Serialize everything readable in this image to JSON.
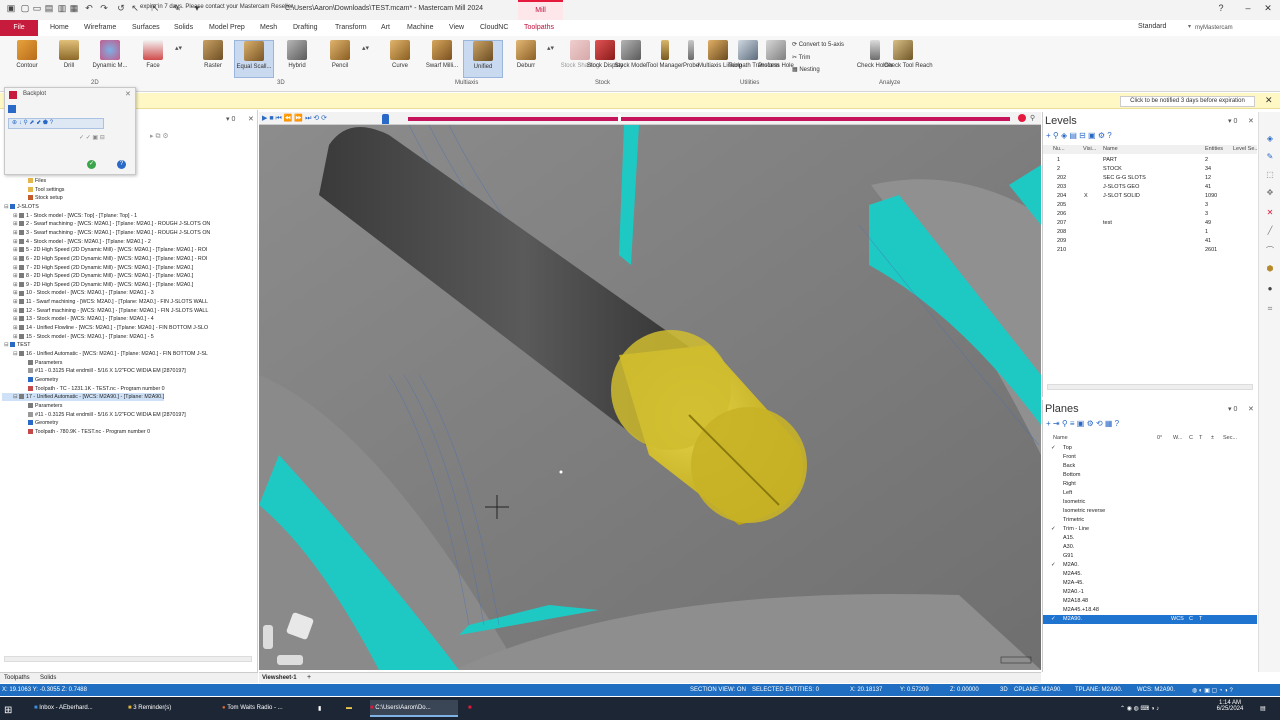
{
  "window": {
    "title": "C:\\Users\\Aaron\\Downloads\\TEST.mcam* - Mastercam Mill 2024",
    "context_tab": "Mill"
  },
  "ribbon": {
    "tabs": [
      "File",
      "Home",
      "Wireframe",
      "Surfaces",
      "Solids",
      "Model Prep",
      "Mesh",
      "Drafting",
      "Transform",
      "Art",
      "Machine",
      "View",
      "CloudNC",
      "Toolpaths"
    ],
    "active_tab": "Toolpaths",
    "workspace": "Standard",
    "my_mastercam": "myMastercam",
    "groups": {
      "2d": "2D",
      "3d": "3D",
      "multiaxis": "Multiaxis",
      "stock": "Stock",
      "utilities": "Utilities",
      "analyze": "Analyze"
    },
    "buttons_2d": [
      "Contour",
      "Drill",
      "Dynamic M...",
      "Face"
    ],
    "buttons_3d": [
      "Raster",
      "Equal Scall...",
      "Hybrid",
      "Pencil"
    ],
    "buttons_multiaxis": [
      "Curve",
      "Swarf Milli...",
      "Unified",
      "Deburr"
    ],
    "buttons_stock": [
      "Stock Shading",
      "Stock Display",
      "Stock Model"
    ],
    "buttons_utilities": [
      "Tool Manager",
      "Probe",
      "Multiaxis Linking",
      "Toolpath Transform",
      "Process Hole"
    ],
    "utilities_small": [
      "Convert to 5-axis",
      "Trim",
      "Nesting"
    ],
    "buttons_analyze": [
      "Check Holder",
      "Check Tool Reach"
    ]
  },
  "notification": {
    "text": "expire in 7 days. Please contact your Mastercam Reseller.",
    "button": "Click to be notified 3 days before expiration",
    "close": "✕"
  },
  "backplot": {
    "title": "Backplot"
  },
  "toolpath_tree": [
    {
      "indent": 2,
      "icon": "folder",
      "text": "Files"
    },
    {
      "indent": 2,
      "icon": "folder",
      "text": "Tool settings"
    },
    {
      "indent": 2,
      "icon": "stock",
      "text": "Stock setup"
    },
    {
      "indent": 0,
      "icon": "group",
      "text": "J-SLOTS",
      "expand": "⊟"
    },
    {
      "indent": 1,
      "icon": "op",
      "text": "1 - Stock model - [WCS: Top] - [Tplane: Top] - 1",
      "expand": "⊞"
    },
    {
      "indent": 1,
      "icon": "op",
      "text": "2 - Swarf machining - [WCS: M2A0.] - [Tplane: M2A0.] - ROUGH J-SLOTS ON",
      "expand": "⊞"
    },
    {
      "indent": 1,
      "icon": "op",
      "text": "3 - Swarf machining - [WCS: M2A0.] - [Tplane: M2A0.] - ROUGH J-SLOTS ON",
      "expand": "⊞"
    },
    {
      "indent": 1,
      "icon": "op",
      "text": "4 - Stock model - [WCS: M2A0.] - [Tplane: M2A0.] - 2",
      "expand": "⊞"
    },
    {
      "indent": 1,
      "icon": "op",
      "text": "5 - 2D High Speed (2D Dynamic Mill) - [WCS: M2A0.] - [Tplane: M2A0.] - ROI",
      "expand": "⊞"
    },
    {
      "indent": 1,
      "icon": "op",
      "text": "6 - 2D High Speed (2D Dynamic Mill) - [WCS: M2A0.] - [Tplane: M2A0.] - ROI",
      "expand": "⊞"
    },
    {
      "indent": 1,
      "icon": "op",
      "text": "7 - 2D High Speed (2D Dynamic Mill) - [WCS: M2A0.] - [Tplane: M2A0.]",
      "expand": "⊞"
    },
    {
      "indent": 1,
      "icon": "op",
      "text": "8 - 2D High Speed (2D Dynamic Mill) - [WCS: M2A0.] - [Tplane: M2A0.]",
      "expand": "⊞"
    },
    {
      "indent": 1,
      "icon": "op",
      "text": "9 - 2D High Speed (2D Dynamic Mill) - [WCS: M2A0.] - [Tplane: M2A0.]",
      "expand": "⊞"
    },
    {
      "indent": 1,
      "icon": "op",
      "text": "10 - Stock model - [WCS: M2A0.] - [Tplane: M2A0.] - 3",
      "expand": "⊞"
    },
    {
      "indent": 1,
      "icon": "op",
      "text": "11 - Swarf machining - [WCS: M2A0.] - [Tplane: M2A0.] - FIN J-SLOTS WALL",
      "expand": "⊞"
    },
    {
      "indent": 1,
      "icon": "op",
      "text": "12 - Swarf machining - [WCS: M2A0.] - [Tplane: M2A0.] - FIN J-SLOTS WALL",
      "expand": "⊞"
    },
    {
      "indent": 1,
      "icon": "op",
      "text": "13 - Stock model - [WCS: M2A0.] - [Tplane: M2A0.] - 4",
      "expand": "⊞"
    },
    {
      "indent": 1,
      "icon": "op",
      "text": "14 - Unified Flowline - [WCS: M2A0.] - [Tplane: M2A0.] - FIN BOTTOM J-SLO",
      "expand": "⊞"
    },
    {
      "indent": 1,
      "icon": "op",
      "text": "15 - Stock model - [WCS: M2A0.] - [Tplane: M2A0.] - 5",
      "expand": "⊞"
    },
    {
      "indent": 0,
      "icon": "group",
      "text": "TEST",
      "expand": "⊟"
    },
    {
      "indent": 1,
      "icon": "op",
      "text": "16 - Unified Automatic - [WCS: M2A0.] - [Tplane: M2A0.] - FIN BOTTOM J-SL",
      "expand": "⊟"
    },
    {
      "indent": 2,
      "icon": "param",
      "text": "Parameters"
    },
    {
      "indent": 2,
      "icon": "tool",
      "text": "#11 - 0.3125 Flat endmill - 5/16 X 1/2\"FOC WIDIA EM [2870197]"
    },
    {
      "indent": 2,
      "icon": "geom",
      "text": "Geometry"
    },
    {
      "indent": 2,
      "icon": "path",
      "text": "Toolpath - TC - 1231.1K - TEST.nc - Program number 0"
    },
    {
      "indent": 1,
      "icon": "op",
      "text": "17 - Unified Automatic - [WCS: M2A90.] - [Tplane: M2A90.]",
      "expand": "⊟",
      "selected": true
    },
    {
      "indent": 2,
      "icon": "param",
      "text": "Parameters"
    },
    {
      "indent": 2,
      "icon": "tool",
      "text": "#11 - 0.3125 Flat endmill - 5/16 X 1/2\"FOC WIDIA EM [2870197]"
    },
    {
      "indent": 2,
      "icon": "geom",
      "text": "Geometry"
    },
    {
      "indent": 2,
      "icon": "path",
      "text": "Toolpath - 780.9K - TEST.nc - Program number 0"
    }
  ],
  "left_tabs": [
    "Toolpaths",
    "Solids"
  ],
  "viewsheet": {
    "label": "Viewsheet-1",
    "add": "+"
  },
  "levels": {
    "title": "Levels",
    "headers": [
      "Nu...",
      "Visi...",
      "Name",
      "Entities",
      "Level Se..."
    ],
    "rows": [
      {
        "num": "1",
        "vis": "",
        "name": "PART",
        "entities": "2"
      },
      {
        "num": "2",
        "vis": "",
        "name": "STOCK",
        "entities": "34"
      },
      {
        "num": "202",
        "vis": "",
        "name": "SEC G-G SLOTS",
        "entities": "12"
      },
      {
        "num": "203",
        "vis": "",
        "name": "J-SLOTS GEO",
        "entities": "41"
      },
      {
        "num": "204",
        "vis": "X",
        "name": "J-SLOT SOLID",
        "entities": "1090"
      },
      {
        "num": "205",
        "vis": "",
        "name": "",
        "entities": "3"
      },
      {
        "num": "206",
        "vis": "",
        "name": "",
        "entities": "3"
      },
      {
        "num": "207",
        "vis": "",
        "name": "test",
        "entities": "49"
      },
      {
        "num": "208",
        "vis": "",
        "name": "",
        "entities": "1"
      },
      {
        "num": "209",
        "vis": "",
        "name": "",
        "entities": "41"
      },
      {
        "num": "210",
        "vis": "",
        "name": "",
        "entities": "2601"
      }
    ]
  },
  "planes": {
    "title": "Planes",
    "headers": [
      "Name",
      "0°",
      "W...",
      "C",
      "T",
      "±",
      "Sec..."
    ],
    "rows": [
      {
        "name": "Top",
        "check": "✓"
      },
      {
        "name": "Front",
        "check": ""
      },
      {
        "name": "Back",
        "check": ""
      },
      {
        "name": "Bottom",
        "check": ""
      },
      {
        "name": "Right",
        "check": ""
      },
      {
        "name": "Left",
        "check": ""
      },
      {
        "name": "Isometric",
        "check": ""
      },
      {
        "name": "Isometric reverse",
        "check": ""
      },
      {
        "name": "Trimetric",
        "check": ""
      },
      {
        "name": "Trim - Line",
        "check": "✓"
      },
      {
        "name": "A15.",
        "check": ""
      },
      {
        "name": "A30.",
        "check": ""
      },
      {
        "name": "G91",
        "check": ""
      },
      {
        "name": "M2A0.",
        "check": "✓"
      },
      {
        "name": "M2A45.",
        "check": ""
      },
      {
        "name": "M2A-45.",
        "check": ""
      },
      {
        "name": "M2A0.-1",
        "check": ""
      },
      {
        "name": "M2A18.48",
        "check": ""
      },
      {
        "name": "M2A45.+18.48",
        "check": ""
      },
      {
        "name": "M2A90.",
        "check": "✓",
        "selected": true,
        "wcs": "WCS",
        "c": "C",
        "t": "T"
      }
    ]
  },
  "statusbar": {
    "coords_left": "X: 19.1063  Y: -0.3055  Z: 0.7488",
    "section_view": "SECTION VIEW: ON",
    "selected": "SELECTED ENTITIES: 0",
    "x": "X:  20.18137",
    "y": "Y:  0.57209",
    "z": "Z:  0.00000",
    "mode": "3D",
    "cplane": "CPLANE: M2A90.",
    "tplane": "TPLANE: M2A90.",
    "wcs": "WCS: M2A90."
  },
  "taskbar": {
    "items": [
      "Inbox - AEberhard...",
      "3 Reminder(s)",
      "Tom Waits Radio - ...",
      "",
      "",
      "C:\\Users\\Aaron\\Do...",
      ""
    ],
    "time": "1:14 AM",
    "date": "6/25/2024"
  },
  "colors": {
    "mastercam_red": "#c71b3d",
    "accent_blue": "#1f6ec1",
    "teal_stock": "#1ec9c4",
    "tool_yellow": "#d6c21f"
  }
}
